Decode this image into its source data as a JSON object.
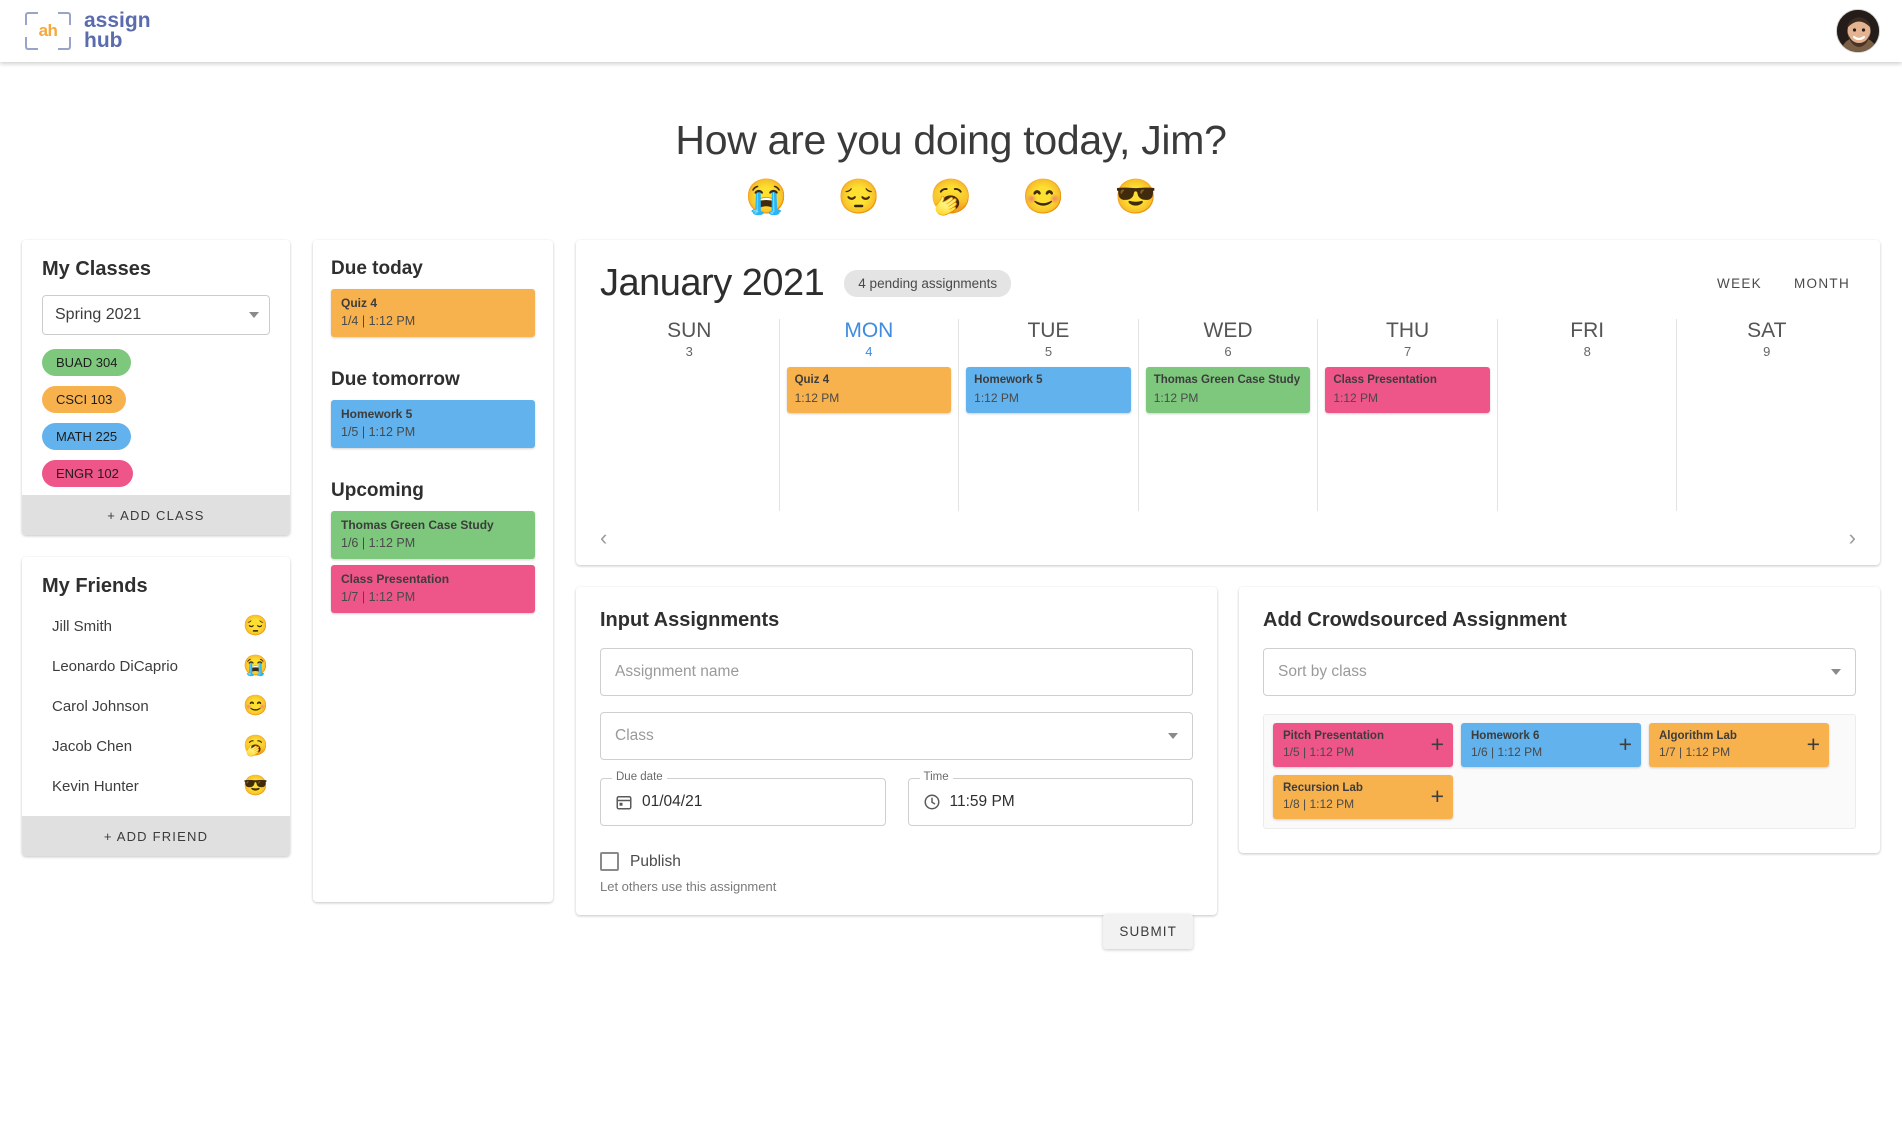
{
  "brand": {
    "name_line1": "assign",
    "name_line2": "hub",
    "monogram": "ah"
  },
  "header": {
    "avatar_alt": "user-avatar"
  },
  "greeting": {
    "text": "How are you doing today, Jim?",
    "moods": [
      {
        "name": "mood-crying",
        "glyph": "😭"
      },
      {
        "name": "mood-sad",
        "glyph": "😔"
      },
      {
        "name": "mood-yawning",
        "glyph": "🥱"
      },
      {
        "name": "mood-happy",
        "glyph": "😊"
      },
      {
        "name": "mood-cool",
        "glyph": "😎"
      }
    ]
  },
  "classes": {
    "title": "My Classes",
    "term_selected": "Spring 2021",
    "items": [
      {
        "label": "BUAD 304",
        "color": "#7DC87D"
      },
      {
        "label": "CSCI 103",
        "color": "#F8B24D"
      },
      {
        "label": "MATH 225",
        "color": "#62B2ED"
      },
      {
        "label": "ENGR 102",
        "color": "#EE5588"
      }
    ],
    "add_label": "+ ADD CLASS"
  },
  "friends": {
    "title": "My Friends",
    "items": [
      {
        "name": "Jill Smith",
        "emoji": "😔"
      },
      {
        "name": "Leonardo DiCaprio",
        "emoji": "😭"
      },
      {
        "name": "Carol Johnson",
        "emoji": "😊"
      },
      {
        "name": "Jacob Chen",
        "emoji": "🥱"
      },
      {
        "name": "Kevin Hunter",
        "emoji": "😎"
      }
    ],
    "add_label": "+ ADD FRIEND"
  },
  "due": {
    "today_title": "Due today",
    "tomorrow_title": "Due tomorrow",
    "upcoming_title": "Upcoming",
    "today": [
      {
        "name": "Quiz 4",
        "meta": "1/4 | 1:12 PM",
        "color": "#F8B24D"
      }
    ],
    "tomorrow": [
      {
        "name": "Homework 5",
        "meta": "1/5 | 1:12 PM",
        "color": "#62B2ED"
      }
    ],
    "upcoming": [
      {
        "name": "Thomas Green Case Study",
        "meta": "1/6 | 1:12 PM",
        "color": "#7DC87D"
      },
      {
        "name": "Class Presentation",
        "meta": "1/7 | 1:12 PM",
        "color": "#EE5588"
      }
    ]
  },
  "calendar": {
    "month": "January 2021",
    "pending_badge": "4 pending assignments",
    "view_week": "WEEK",
    "view_month": "MONTH",
    "prev_icon": "‹",
    "next_icon": "›",
    "days": [
      {
        "name": "SUN",
        "num": "3",
        "today": false,
        "events": []
      },
      {
        "name": "MON",
        "num": "4",
        "today": true,
        "events": [
          {
            "name": "Quiz 4",
            "time": "1:12 PM",
            "color": "#F8B24D"
          }
        ]
      },
      {
        "name": "TUE",
        "num": "5",
        "today": false,
        "events": [
          {
            "name": "Homework 5",
            "time": "1:12 PM",
            "color": "#62B2ED"
          }
        ]
      },
      {
        "name": "WED",
        "num": "6",
        "today": false,
        "events": [
          {
            "name": "Thomas Green Case Study",
            "time": "1:12 PM",
            "color": "#7DC87D"
          }
        ]
      },
      {
        "name": "THU",
        "num": "7",
        "today": false,
        "events": [
          {
            "name": "Class Presentation",
            "time": "1:12 PM",
            "color": "#EE5588"
          }
        ]
      },
      {
        "name": "FRI",
        "num": "8",
        "today": false,
        "events": []
      },
      {
        "name": "SAT",
        "num": "9",
        "today": false,
        "events": []
      }
    ]
  },
  "input_form": {
    "title": "Input Assignments",
    "name_placeholder": "Assignment name",
    "name_value": "",
    "class_placeholder": "Class",
    "due_date_label": "Due date",
    "due_date_value": "01/04/21",
    "time_label": "Time",
    "time_value": "11:59 PM",
    "publish_label": "Publish",
    "publish_hint": "Let others use this assignment",
    "publish_checked": false,
    "submit_label": "SUBMIT"
  },
  "crowdsourced": {
    "title": "Add Crowdsourced Assignment",
    "sort_placeholder": "Sort by class",
    "items": [
      {
        "name": "Pitch Presentation",
        "meta": "1/5 | 1:12 PM",
        "color": "#EE5588",
        "add_icon": "+"
      },
      {
        "name": "Homework 6",
        "meta": "1/6 | 1:12 PM",
        "color": "#62B2ED",
        "add_icon": "+"
      },
      {
        "name": "Algorithm Lab",
        "meta": "1/7 | 1:12 PM",
        "color": "#F8B24D",
        "add_icon": "+"
      },
      {
        "name": "Recursion Lab",
        "meta": "1/8 | 1:12 PM",
        "color": "#F8B24D",
        "add_icon": "+"
      }
    ]
  }
}
